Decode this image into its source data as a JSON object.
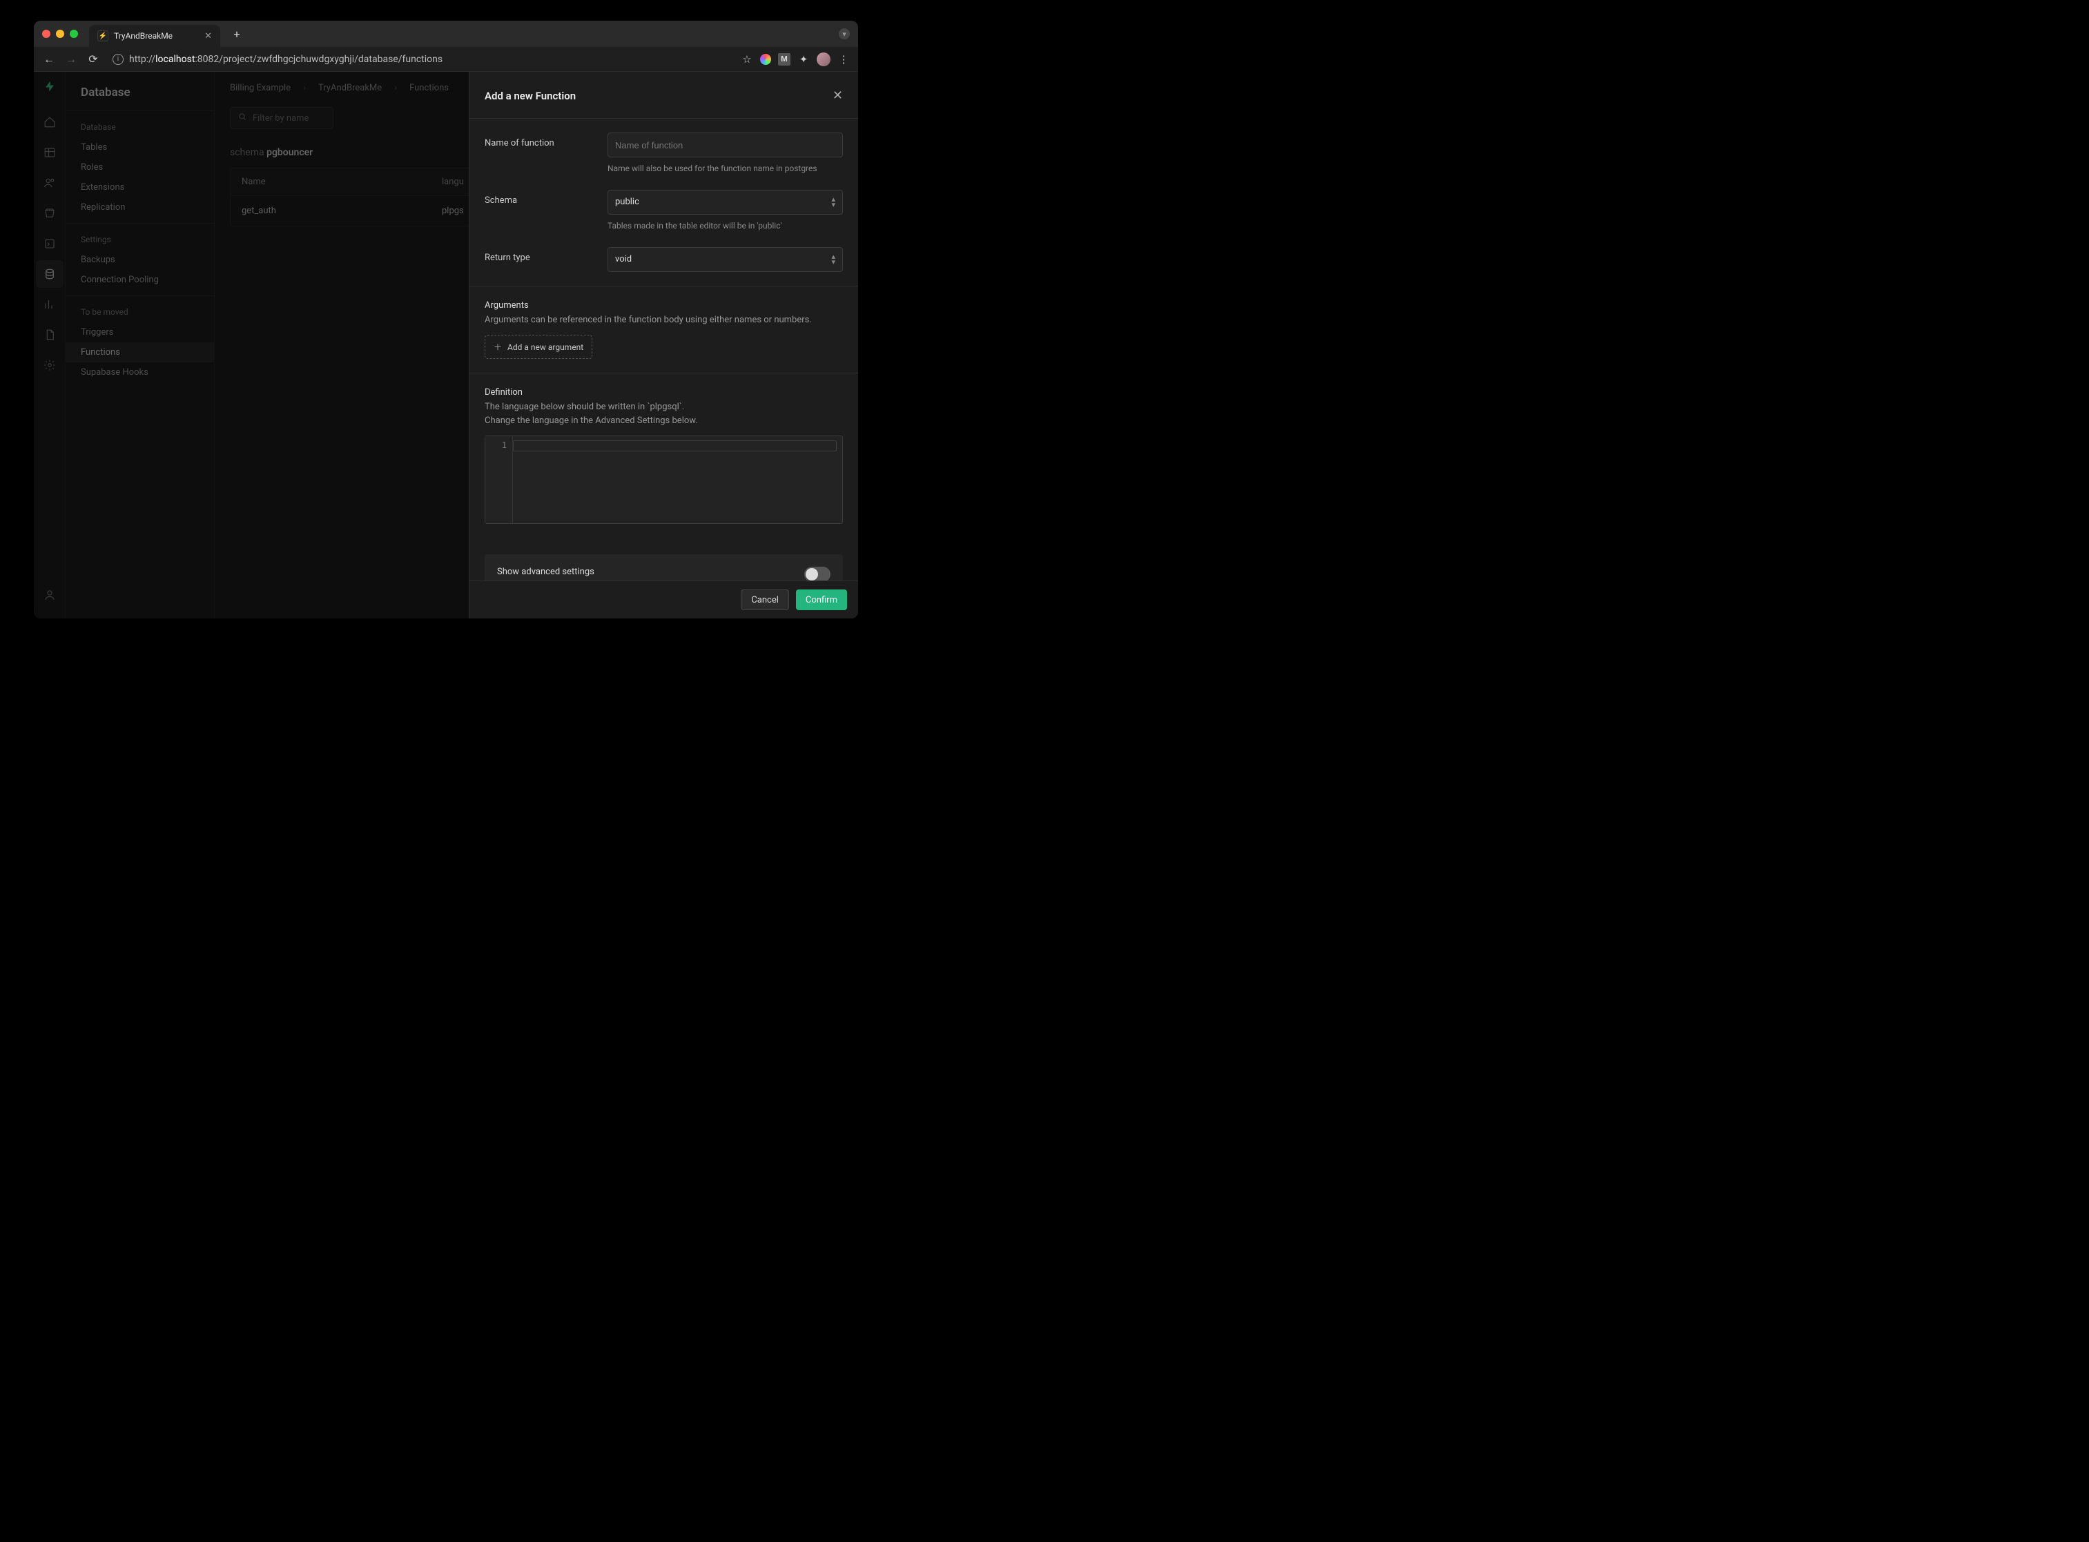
{
  "browser": {
    "tab_title": "TryAndBreakMe",
    "url_prefix": "http://",
    "url_host": "localhost",
    "url_rest": ":8082/project/zwfdhgcjchuwdgxyghji/database/functions"
  },
  "sidebar": {
    "title": "Database",
    "section1_header": "Database",
    "section1_items": [
      "Tables",
      "Roles",
      "Extensions",
      "Replication"
    ],
    "section2_header": "Settings",
    "section2_items": [
      "Backups",
      "Connection Pooling"
    ],
    "section3_header": "To be moved",
    "section3_items": [
      "Triggers",
      "Functions",
      "Supabase Hooks"
    ],
    "section3_selected_index": 1
  },
  "breadcrumbs": {
    "a": "Billing Example",
    "b": "TryAndBreakMe",
    "c": "Functions"
  },
  "filter_placeholder": "Filter by name",
  "schema_label": "schema",
  "schema_value": "pgbouncer",
  "table": {
    "head_name": "Name",
    "head_lang": "langu",
    "row_name": "get_auth",
    "row_lang": "plpgs"
  },
  "panel": {
    "title": "Add a new Function",
    "name_label": "Name of function",
    "name_placeholder": "Name of function",
    "name_hint": "Name will also be used for the function name in postgres",
    "schema_label": "Schema",
    "schema_value": "public",
    "schema_hint": "Tables made in the table editor will be in 'public'",
    "return_label": "Return type",
    "return_value": "void",
    "args_label": "Arguments",
    "args_desc": "Arguments can be referenced in the function body using either names or numbers.",
    "add_arg": "Add a new argument",
    "def_label": "Definition",
    "def_desc1": "The language below should be written in `plpgsql`.",
    "def_desc2": "Change the language in the Advanced Settings below.",
    "editor_line": "1",
    "adv_label": "Show advanced settings",
    "cancel": "Cancel",
    "confirm": "Confirm"
  }
}
